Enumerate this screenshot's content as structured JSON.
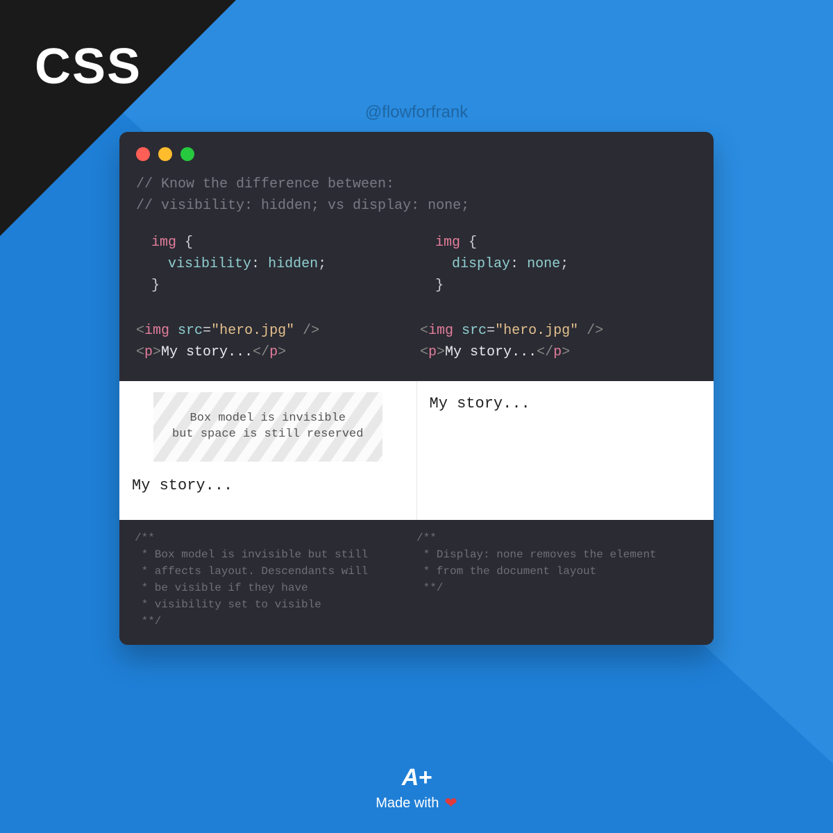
{
  "corner_label": "CSS",
  "handle": "@flowforfrank",
  "comment_line1": "// Know the difference between:",
  "comment_line2": "// visibility: hidden; vs display: none;",
  "left": {
    "selector": "img",
    "property": "visibility",
    "value": "hidden",
    "img_tag": "img",
    "img_attr": "src",
    "img_val": "\"hero.jpg\"",
    "p_tag": "p",
    "p_text": "My story",
    "ellipsis": "..."
  },
  "right": {
    "selector": "img",
    "property": "display",
    "value": "none",
    "img_tag": "img",
    "img_attr": "src",
    "img_val": "\"hero.jpg\"",
    "p_tag": "p",
    "p_text": "My story",
    "ellipsis": "..."
  },
  "preview": {
    "placeholder_l1": "Box model is invisible",
    "placeholder_l2": "but space is still reserved",
    "left_story": "My story...",
    "right_story": "My story..."
  },
  "notes": {
    "left": "/**\n * Box model is invisible but still\n * affects layout. Descendants will\n * be visible if they have\n * visibility set to visible\n **/",
    "right": "/**\n * Display: none removes the element\n * from the document layout\n **/"
  },
  "footer": {
    "logo": "A+",
    "made": "Made with"
  }
}
